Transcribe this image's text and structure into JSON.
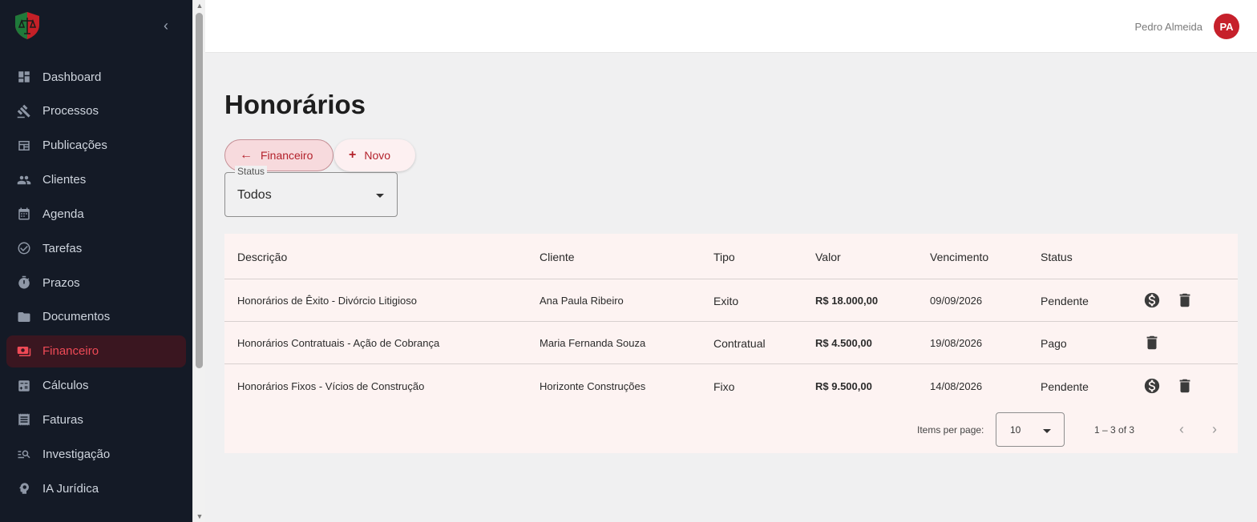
{
  "sidebar": {
    "items": [
      {
        "label": "Dashboard",
        "icon": "dashboard-icon"
      },
      {
        "label": "Processos",
        "icon": "gavel-icon"
      },
      {
        "label": "Publicações",
        "icon": "newspaper-icon"
      },
      {
        "label": "Clientes",
        "icon": "people-icon"
      },
      {
        "label": "Agenda",
        "icon": "calendar-icon"
      },
      {
        "label": "Tarefas",
        "icon": "check-circle-icon"
      },
      {
        "label": "Prazos",
        "icon": "stopwatch-icon"
      },
      {
        "label": "Documentos",
        "icon": "folder-icon"
      },
      {
        "label": "Financeiro",
        "icon": "payments-icon",
        "active": true
      },
      {
        "label": "Cálculos",
        "icon": "calculator-icon"
      },
      {
        "label": "Faturas",
        "icon": "receipt-icon"
      },
      {
        "label": "Investigação",
        "icon": "manage-search-icon"
      },
      {
        "label": "IA Jurídica",
        "icon": "psychology-icon"
      }
    ]
  },
  "header": {
    "user_name": "Pedro Almeida",
    "avatar_initials": "PA"
  },
  "page": {
    "title": "Honorários",
    "back_button": "Financeiro",
    "new_button": "Novo",
    "status_filter": {
      "label": "Status",
      "value": "Todos"
    }
  },
  "table": {
    "columns": [
      "Descrição",
      "Cliente",
      "Tipo",
      "Valor",
      "Vencimento",
      "Status"
    ],
    "rows": [
      {
        "descricao": "Honorários de Êxito - Divórcio Litigioso",
        "cliente": "Ana Paula Ribeiro",
        "tipo": "Exito",
        "valor": "R$ 18.000,00",
        "vencimento": "09/09/2026",
        "status": "Pendente",
        "actions": [
          "pay-icon",
          "delete-icon"
        ]
      },
      {
        "descricao": "Honorários Contratuais - Ação de Cobrança",
        "cliente": "Maria Fernanda Souza",
        "tipo": "Contratual",
        "valor": "R$ 4.500,00",
        "vencimento": "19/08/2026",
        "status": "Pago",
        "actions": [
          "delete-icon"
        ]
      },
      {
        "descricao": "Honorários Fixos - Vícios de Construção",
        "cliente": "Horizonte Construções",
        "tipo": "Fixo",
        "valor": "R$ 9.500,00",
        "vencimento": "14/08/2026",
        "status": "Pendente",
        "actions": [
          "pay-icon",
          "delete-icon"
        ]
      }
    ]
  },
  "paginator": {
    "items_per_page_label": "Items per page:",
    "items_per_page": "10",
    "range": "1 – 3 of 3"
  },
  "colors": {
    "sidebar_bg": "#141a26",
    "accent": "#ef4a56",
    "avatar": "#c6202b",
    "table_bg": "#fdf3f2"
  }
}
